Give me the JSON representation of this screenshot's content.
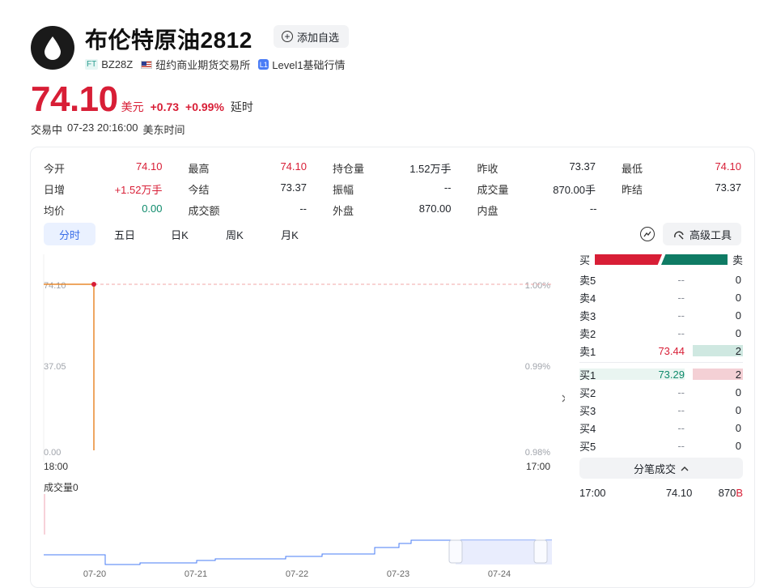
{
  "header": {
    "title": "布伦特原油2812",
    "add_label": "添加自选",
    "code_tag": "FT",
    "code": "BZ28Z",
    "exchange": "纽约商业期货交易所",
    "level_tag": "L1",
    "level": "Level1基础行情"
  },
  "quote": {
    "price": "74.10",
    "unit": "美元",
    "change": "+0.73",
    "change_pct": "+0.99%",
    "delay": "延时",
    "status": "交易中",
    "time": "07-23 20:16:00",
    "tz": "美东时间"
  },
  "stats": [
    [
      {
        "k": "今开",
        "v": "74.10",
        "c": "red"
      },
      {
        "k": "最高",
        "v": "74.10",
        "c": "red"
      },
      {
        "k": "持仓量",
        "v": "1.52万手",
        "c": ""
      },
      {
        "k": "昨收",
        "v": "73.37",
        "c": ""
      },
      {
        "k": "最低",
        "v": "74.10",
        "c": "red"
      }
    ],
    [
      {
        "k": "日增",
        "v": "+1.52万手",
        "c": "red"
      },
      {
        "k": "今结",
        "v": "73.37",
        "c": ""
      },
      {
        "k": "振幅",
        "v": "--",
        "c": ""
      },
      {
        "k": "成交量",
        "v": "870.00手",
        "c": ""
      },
      {
        "k": "昨结",
        "v": "73.37",
        "c": ""
      }
    ],
    [
      {
        "k": "均价",
        "v": "0.00",
        "c": "green"
      },
      {
        "k": "成交额",
        "v": "--",
        "c": ""
      },
      {
        "k": "外盘",
        "v": "870.00",
        "c": ""
      },
      {
        "k": "内盘",
        "v": "--",
        "c": ""
      }
    ]
  ],
  "tabs": [
    "分时",
    "五日",
    "日K",
    "周K",
    "月K"
  ],
  "active_tab": 0,
  "tools": {
    "advanced": "高级工具"
  },
  "chart_data": {
    "type": "line",
    "y_labels": [
      "74.10",
      "37.05",
      "0.00"
    ],
    "pct_labels": [
      "1.00%",
      "0.99%",
      "0.98%"
    ],
    "x_labels": [
      "18:00",
      "17:00"
    ],
    "ylim": [
      0,
      74.1
    ],
    "series": [
      {
        "values": [
          74.1,
          74.1,
          0
        ]
      }
    ],
    "prev_close_line": 74.1,
    "volume_label": "成交量0",
    "overview_dates": [
      "07-20",
      "07-21",
      "07-22",
      "07-23",
      "07-24"
    ],
    "colors": {
      "line": "#e8892f",
      "dot": "#d81e36",
      "guide": "#f0a7a7",
      "overview": "#4a7cf6"
    }
  },
  "orderbook": {
    "buy_label": "买",
    "sell_label": "卖",
    "asks": [
      {
        "lbl": "卖5",
        "p": "--",
        "q": "0"
      },
      {
        "lbl": "卖4",
        "p": "--",
        "q": "0"
      },
      {
        "lbl": "卖3",
        "p": "--",
        "q": "0"
      },
      {
        "lbl": "卖2",
        "p": "--",
        "q": "0"
      },
      {
        "lbl": "卖1",
        "p": "73.44",
        "q": "2"
      }
    ],
    "bids": [
      {
        "lbl": "买1",
        "p": "73.29",
        "q": "2"
      },
      {
        "lbl": "买2",
        "p": "--",
        "q": "0"
      },
      {
        "lbl": "买3",
        "p": "--",
        "q": "0"
      },
      {
        "lbl": "买4",
        "p": "--",
        "q": "0"
      },
      {
        "lbl": "买5",
        "p": "--",
        "q": "0"
      }
    ],
    "trades_label": "分笔成交",
    "trade": {
      "time": "17:00",
      "price": "74.10",
      "vol": "870",
      "side": "B"
    }
  }
}
